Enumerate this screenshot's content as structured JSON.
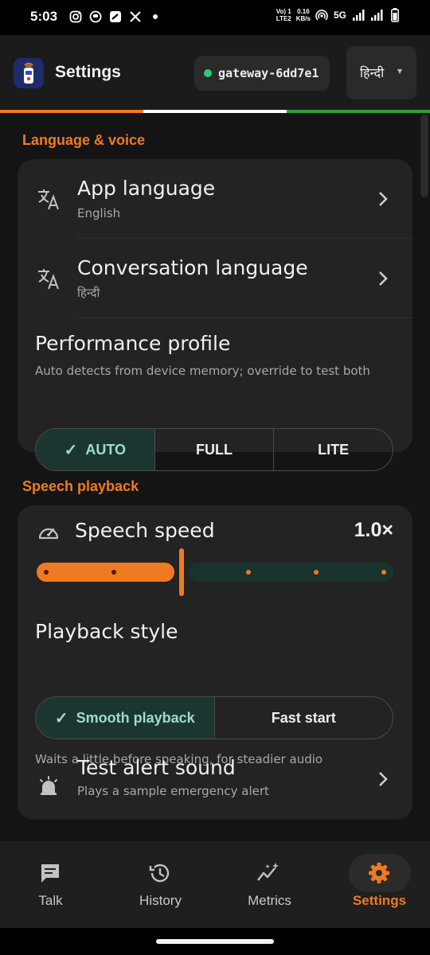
{
  "status_bar": {
    "time": "5:03",
    "left_icons": [
      "instagram-icon",
      "app-icon",
      "app-icon",
      "x-twitter-icon",
      "notification-dot-icon"
    ],
    "volte_top": "Vo) 1",
    "volte_bottom": "LTE2",
    "speed_top": "0.16",
    "speed_bottom": "KB/s",
    "network": "5G"
  },
  "header": {
    "title": "Settings",
    "gateway_label": "gateway-6dd7e1",
    "gateway_status_color": "#2ecc71",
    "language_selector": "हिन्दी",
    "tricolor": [
      "#f07a22",
      "#ffffff",
      "#2e9e3a"
    ]
  },
  "sections": {
    "language": {
      "heading": "Language & voice",
      "app_language": {
        "title": "App language",
        "value": "English"
      },
      "conversation_language": {
        "title": "Conversation language",
        "value": "हिन्दी"
      },
      "performance": {
        "title": "Performance profile",
        "description": "Auto detects from device memory; override to test both",
        "options": [
          "AUTO",
          "FULL",
          "LITE"
        ],
        "selected": "AUTO"
      }
    },
    "speech": {
      "heading": "Speech playback",
      "speed": {
        "title": "Speech speed",
        "value": "1.0×",
        "fraction": 0.4,
        "steps": 6
      },
      "playback_style": {
        "title": "Playback style",
        "options": [
          "Smooth playback",
          "Fast start"
        ],
        "selected": "Smooth playback",
        "description": "Waits a little before speaking, for steadier audio"
      },
      "alert": {
        "title": "Test alert sound",
        "description": "Plays a sample emergency alert"
      }
    }
  },
  "nav": {
    "items": [
      {
        "label": "Talk",
        "icon": "chat-icon",
        "active": false
      },
      {
        "label": "History",
        "icon": "history-icon",
        "active": false
      },
      {
        "label": "Metrics",
        "icon": "metrics-icon",
        "active": false
      },
      {
        "label": "Settings",
        "icon": "gear-icon",
        "active": true
      }
    ]
  },
  "colors": {
    "accent": "#f07a22",
    "selected_bg": "#1b3631",
    "selected_text": "#9fdcc8",
    "card_bg": "#232323"
  }
}
